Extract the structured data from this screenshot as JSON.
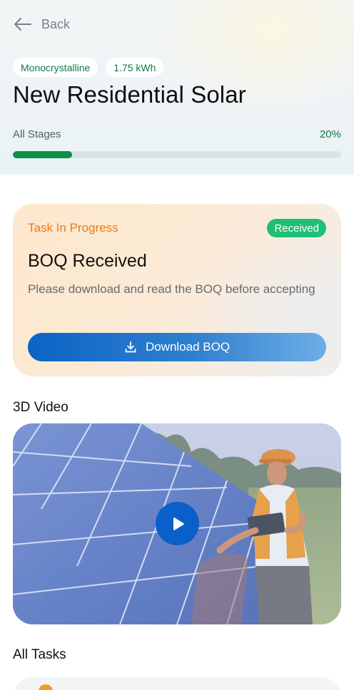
{
  "nav": {
    "back_label": "Back"
  },
  "project": {
    "tags": [
      "Monocrystalline",
      "1.75 kWh"
    ],
    "title": "New Residential Solar",
    "stage_label": "All Stages",
    "progress_label": "20%",
    "progress_fraction": 0.18
  },
  "task": {
    "status": "Task In Progress",
    "badge": "Received",
    "title": "BOQ Received",
    "description": "Please download and read the BOQ before accepting",
    "button_label": "Download BOQ",
    "button_icon": "download-icon"
  },
  "video_section": {
    "title": "3D Video",
    "play_icon": "play-icon"
  },
  "tasks_section": {
    "title": "All Tasks"
  },
  "colors": {
    "brand_green": "#0e8f47",
    "accent_orange": "#ea7a14",
    "badge_green": "#1fbf74",
    "button_blue": "#0b64c4"
  }
}
